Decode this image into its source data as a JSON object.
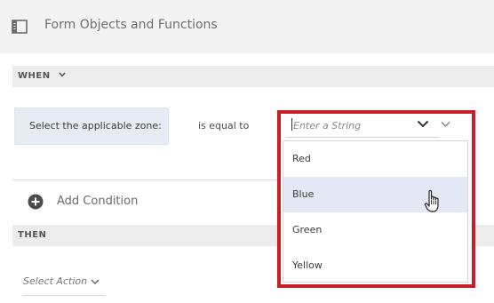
{
  "header": {
    "title": "Form Objects and Functions",
    "icon": "panel-icon"
  },
  "when": {
    "label": "WHEN",
    "condition_field": "Select the applicable zone:",
    "operator": "is equal to",
    "value_placeholder": "Enter a String"
  },
  "dropdown": {
    "options": [
      "Red",
      "Blue",
      "Green",
      "Yellow"
    ],
    "hovered_option": "Blue",
    "highlight_color": "#c81e25"
  },
  "add_condition": {
    "label": "Add Condition",
    "icon": "plus-circle-icon"
  },
  "then": {
    "label": "THEN",
    "action_placeholder": "Select Action"
  },
  "colors": {
    "hover_bg": "#e3e9f4",
    "condition_bg": "#e6ecf3"
  }
}
